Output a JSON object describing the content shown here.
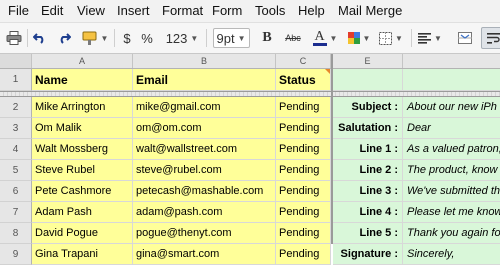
{
  "menu": [
    "File",
    "Edit",
    "View",
    "Insert",
    "Format",
    "Form",
    "Tools",
    "Help",
    "Mail Merge"
  ],
  "toolbar": {
    "currency": "$",
    "percent": "%",
    "number_format": "123",
    "font_size": "9pt",
    "bold": "B",
    "strikethrough": "Abc",
    "text_color": "A"
  },
  "columns": [
    "A",
    "B",
    "C",
    "E"
  ],
  "rows": [
    "1",
    "2",
    "3",
    "4",
    "5",
    "6",
    "7",
    "8",
    "9"
  ],
  "header": {
    "name": "Name",
    "email": "Email",
    "status": "Status"
  },
  "contacts": [
    {
      "name": "Mike Arrington",
      "email": "mike@gmail.com",
      "status": "Pending"
    },
    {
      "name": "Om Malik",
      "email": "om@om.com",
      "status": "Pending"
    },
    {
      "name": "Walt Mossberg",
      "email": "walt@wallstreet.com",
      "status": "Pending"
    },
    {
      "name": "Steve Rubel",
      "email": "steve@rubel.com",
      "status": "Pending"
    },
    {
      "name": "Pete Cashmore",
      "email": "petecash@mashable.com",
      "status": "Pending"
    },
    {
      "name": "Adam Pash",
      "email": "adam@pash.com",
      "status": "Pending"
    },
    {
      "name": "David Pogue",
      "email": "pogue@thenyt.com",
      "status": "Pending"
    },
    {
      "name": "Gina Trapani",
      "email": "gina@smart.com",
      "status": "Pending"
    }
  ],
  "template": [
    {
      "label": "Subject :",
      "text": "About our new iPh"
    },
    {
      "label": "Salutation :",
      "text": "Dear"
    },
    {
      "label": "Line 1 :",
      "text": "As a valued patron,"
    },
    {
      "label": "Line 2 :",
      "text": "The product, know"
    },
    {
      "label": "Line 3 :",
      "text": "We've submitted th"
    },
    {
      "label": "Line 4 :",
      "text": "Please let me know"
    },
    {
      "label": "Line 5 :",
      "text": "Thank you again fo"
    },
    {
      "label": "Signature :",
      "text": "Sincerely,"
    }
  ],
  "colors": {
    "yellow": "#ffff99",
    "green": "#d9f7d9",
    "accent_corner": "#e8872b"
  }
}
